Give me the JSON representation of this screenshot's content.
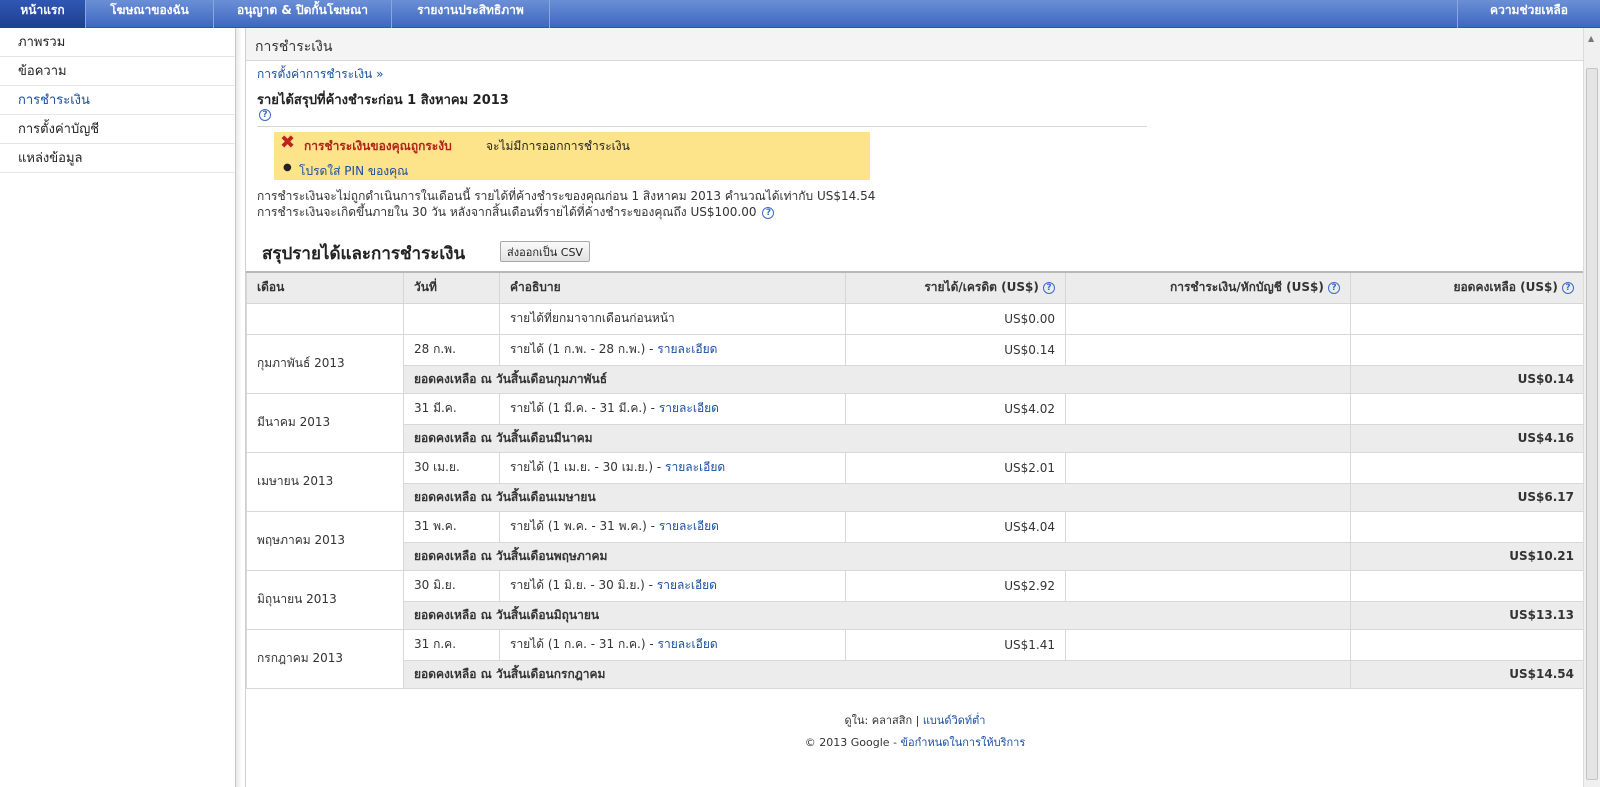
{
  "nav": {
    "tabs": [
      {
        "label": "หน้าแรก",
        "active": true
      },
      {
        "label": "โฆษณาของฉัน",
        "active": false
      },
      {
        "label": "อนุญาต & ปิดกั้นโฆษณา",
        "active": false
      },
      {
        "label": "รายงานประสิทธิภาพ",
        "active": false
      }
    ],
    "help_label": "ความช่วยเหลือ"
  },
  "sidebar": {
    "items": [
      {
        "label": "ภาพรวม",
        "active": false
      },
      {
        "label": "ข้อความ",
        "active": false
      },
      {
        "label": "การชำระเงิน",
        "active": true
      },
      {
        "label": "การตั้งค่าบัญชี",
        "active": false
      },
      {
        "label": "แหล่งข้อมูล",
        "active": false
      }
    ]
  },
  "page": {
    "title": "การชำระเงิน",
    "settings_link": "การตั้งค่าการชำระเงิน »",
    "unpaid_title": "รายได้สรุปที่ค้างชำระก่อน 1 สิงหาคม 2013",
    "help_glyph": "?"
  },
  "alert": {
    "hold_text": "การชำระเงินของคุณถูกระงับ",
    "no_payment_text": "จะไม่มีการออกการชำระเงิน",
    "pin_link": "โปรดใส่ PIN ของคุณ",
    "bg_color": "#fde38a"
  },
  "explain": {
    "line1": "การชำระเงินจะไม่ถูกดำเนินการในเดือนนี้ รายได้ที่ค้างชำระของคุณก่อน 1 สิงหาคม 2013 คำนวณได้เท่ากับ US$14.54",
    "line2": "การชำระเงินจะเกิดขึ้นภายใน 30 วัน หลังจากสิ้นเดือนที่รายได้ที่ค้างชำระของคุณถึง US$100.00"
  },
  "summary": {
    "title": "สรุปรายได้และการชำระเงิน",
    "csv_button": "ส่งออกเป็น CSV"
  },
  "table": {
    "headers": {
      "month": "เดือน",
      "date": "วันที่",
      "description": "คำอธิบาย",
      "earnings": "รายได้/เครดิต (US$)",
      "payments": "การชำระเงิน/หักบัญชี (US$)",
      "balance": "ยอดคงเหลือ (US$)"
    },
    "carry": {
      "description": "รายได้ที่ยกมาจากเดือนก่อนหน้า",
      "earnings": "US$0.00"
    },
    "detail_link": "รายละเอียด",
    "rows": [
      {
        "month": "กุมภาพันธ์ 2013",
        "date": "28 ก.พ.",
        "desc": "รายได้ (1 ก.พ. - 28 ก.พ.) -",
        "earnings": "US$0.14",
        "bal_label": "ยอดคงเหลือ ณ วันสิ้นเดือนกุมภาพันธ์",
        "balance": "US$0.14"
      },
      {
        "month": "มีนาคม 2013",
        "date": "31 มี.ค.",
        "desc": "รายได้ (1 มี.ค. - 31 มี.ค.) -",
        "earnings": "US$4.02",
        "bal_label": "ยอดคงเหลือ ณ วันสิ้นเดือนมีนาคม",
        "balance": "US$4.16"
      },
      {
        "month": "เมษายน 2013",
        "date": "30 เม.ย.",
        "desc": "รายได้ (1 เม.ย. - 30 เม.ย.) -",
        "earnings": "US$2.01",
        "bal_label": "ยอดคงเหลือ ณ วันสิ้นเดือนเมษายน",
        "balance": "US$6.17"
      },
      {
        "month": "พฤษภาคม 2013",
        "date": "31 พ.ค.",
        "desc": "รายได้ (1 พ.ค. - 31 พ.ค.) -",
        "earnings": "US$4.04",
        "bal_label": "ยอดคงเหลือ ณ วันสิ้นเดือนพฤษภาคม",
        "balance": "US$10.21"
      },
      {
        "month": "มิถุนายน 2013",
        "date": "30 มิ.ย.",
        "desc": "รายได้ (1 มิ.ย. - 30 มิ.ย.) -",
        "earnings": "US$2.92",
        "bal_label": "ยอดคงเหลือ ณ วันสิ้นเดือนมิถุนายน",
        "balance": "US$13.13"
      },
      {
        "month": "กรกฎาคม 2013",
        "date": "31 ก.ค.",
        "desc": "รายได้ (1 ก.ค. - 31 ก.ค.) -",
        "earnings": "US$1.41",
        "bal_label": "ยอดคงเหลือ ณ วันสิ้นเดือนกรกฎาคม",
        "balance": "US$14.54"
      }
    ]
  },
  "footer": {
    "view_label": "ดูใน:",
    "classic": "คลาสสิก",
    "separator": "|",
    "low_bandwidth": "แบนด์วิดท์ต่ำ",
    "copyright": "© 2013 Google -",
    "terms": "ข้อกำหนดในการให้บริการ"
  }
}
